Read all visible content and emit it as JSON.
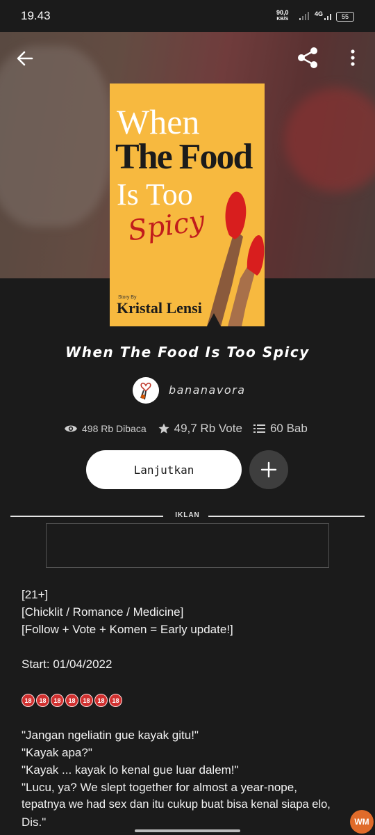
{
  "status": {
    "time": "19.43",
    "speed": "90,0",
    "speed_unit": "KB/S",
    "network": "4G",
    "battery": "55"
  },
  "icons": {
    "back": "arrow-left-icon",
    "share": "share-icon",
    "more": "more-vertical-icon",
    "views": "eye-icon",
    "votes": "star-icon",
    "chapters": "list-icon",
    "add": "plus-icon"
  },
  "cover": {
    "line1": "When",
    "line2": "The Food",
    "line3": "Is Too",
    "line4": "Spicy",
    "story_by": "Story By",
    "author": "Kristal Lensi"
  },
  "story": {
    "title": "When The Food Is Too Spicy",
    "username": "bananavora",
    "views": "498 Rb Dibaca",
    "votes": "49,7 Rb Vote",
    "chapters": "60 Bab"
  },
  "actions": {
    "continue_label": "Lanjutkan"
  },
  "ad": {
    "label": "IKLAN"
  },
  "description": {
    "line1": "[21+]",
    "line2": "[Chicklit / Romance / Medicine]",
    "line3": "[Follow + Vote + Komen = Early update!]",
    "line4": "Start: 01/04/2022",
    "emoji_text": "18",
    "line5": "\"Jangan ngeliatin gue kayak gitu!\"",
    "line6": "\"Kayak apa?\"",
    "line7": "\"Kayak ... kayak lo kenal gue luar dalem!\"",
    "line8": "\"Lucu, ya? We slept together for almost a year-nope,",
    "line9": "tepatnya we had sex dan itu cukup buat bisa kenal siapa elo,",
    "line10": "Dis.\""
  },
  "watermark": "WM",
  "colors": {
    "background": "#1b1b1b",
    "cover_bg": "#f7b93f",
    "cover_accent": "#c11c1c",
    "button_bg": "#ffffff",
    "add_button_bg": "#3e3e3e"
  }
}
